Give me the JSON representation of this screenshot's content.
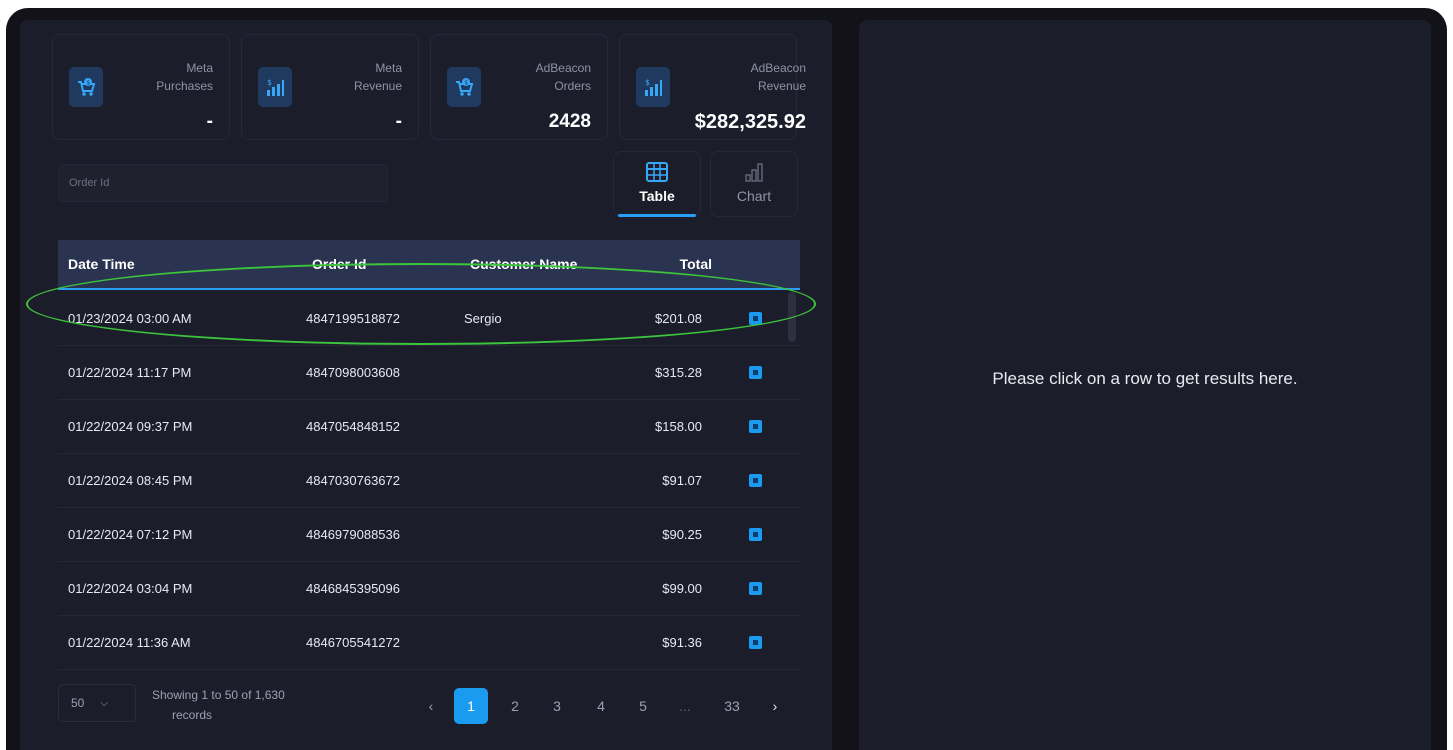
{
  "metrics": [
    {
      "label_line1": "Meta",
      "label_line2": "Purchases",
      "value": "-",
      "icon": "cart-dollar-icon"
    },
    {
      "label_line1": "Meta",
      "label_line2": "Revenue",
      "value": "-",
      "icon": "bar-chart-dollar-icon"
    },
    {
      "label_line1": "AdBeacon",
      "label_line2": "Orders",
      "value": "2428",
      "icon": "cart-dollar-icon"
    },
    {
      "label_line1": "AdBeacon",
      "label_line2": "Revenue",
      "value": "$282,325.92",
      "icon": "bar-chart-dollar-icon"
    }
  ],
  "search": {
    "placeholder": "Order Id"
  },
  "views": {
    "table_label": "Table",
    "chart_label": "Chart",
    "active": "Table"
  },
  "table": {
    "headers": {
      "date": "Date Time",
      "order": "Order Id",
      "customer": "Customer Name",
      "total": "Total"
    },
    "rows": [
      {
        "date": "01/23/2024 03:00 AM",
        "order": "4847199518872",
        "customer": "Sergio",
        "total": "$201.08"
      },
      {
        "date": "01/22/2024 11:17 PM",
        "order": "4847098003608",
        "customer": "",
        "total": "$315.28"
      },
      {
        "date": "01/22/2024 09:37 PM",
        "order": "4847054848152",
        "customer": "",
        "total": "$158.00"
      },
      {
        "date": "01/22/2024 08:45 PM",
        "order": "4847030763672",
        "customer": "",
        "total": "$91.07"
      },
      {
        "date": "01/22/2024 07:12 PM",
        "order": "4846979088536",
        "customer": "",
        "total": "$90.25"
      },
      {
        "date": "01/22/2024 03:04 PM",
        "order": "4846845395096",
        "customer": "",
        "total": "$99.00"
      },
      {
        "date": "01/22/2024 11:36 AM",
        "order": "4846705541272",
        "customer": "",
        "total": "$91.36"
      }
    ]
  },
  "pagination": {
    "page_size": "50",
    "showing_line1": "Showing 1 to 50 of 1,630",
    "showing_line2": "records",
    "prev": "‹",
    "next": "›",
    "pages": [
      "1",
      "2",
      "3",
      "4",
      "5",
      "...",
      "33"
    ],
    "current": "1"
  },
  "details": {
    "empty_message": "Please click on a row to get results here."
  },
  "colors": {
    "accent": "#1a9bf0",
    "panel": "#1c1d2b",
    "background": "#121218",
    "highlight": "#3cc43c"
  }
}
